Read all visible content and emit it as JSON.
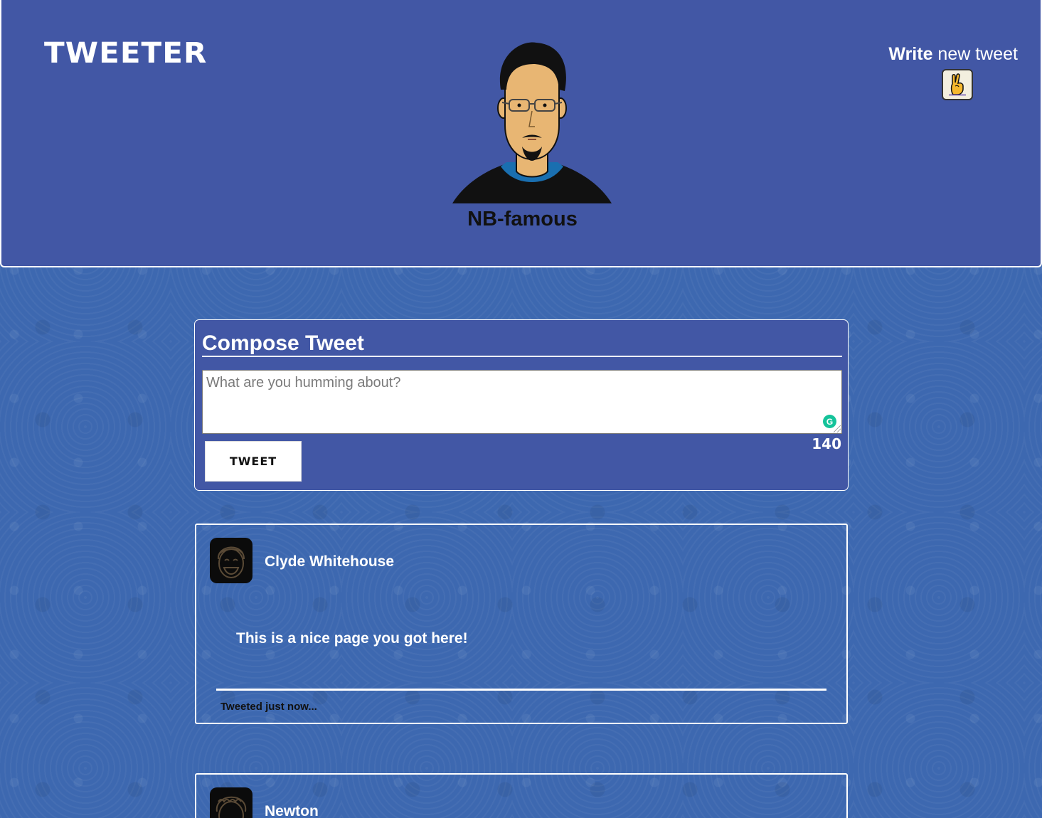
{
  "header": {
    "logo": "TWEETER",
    "profile_name": "NB-famous",
    "write_bold": "Write",
    "write_rest": " new tweet",
    "write_icon": "victory-hand-icon"
  },
  "compose": {
    "title": "Compose Tweet",
    "placeholder": "What are you humming about?",
    "button_label": "TWEET",
    "counter": "140"
  },
  "tweets": [
    {
      "author": "Clyde Whitehouse",
      "text": "This is a nice page you got here!",
      "time": "Tweeted just now..."
    },
    {
      "author": "Newton"
    }
  ],
  "colors": {
    "header_bg": "#4257a5",
    "page_bg": "#3d68b0",
    "accent": "#ffffff"
  }
}
